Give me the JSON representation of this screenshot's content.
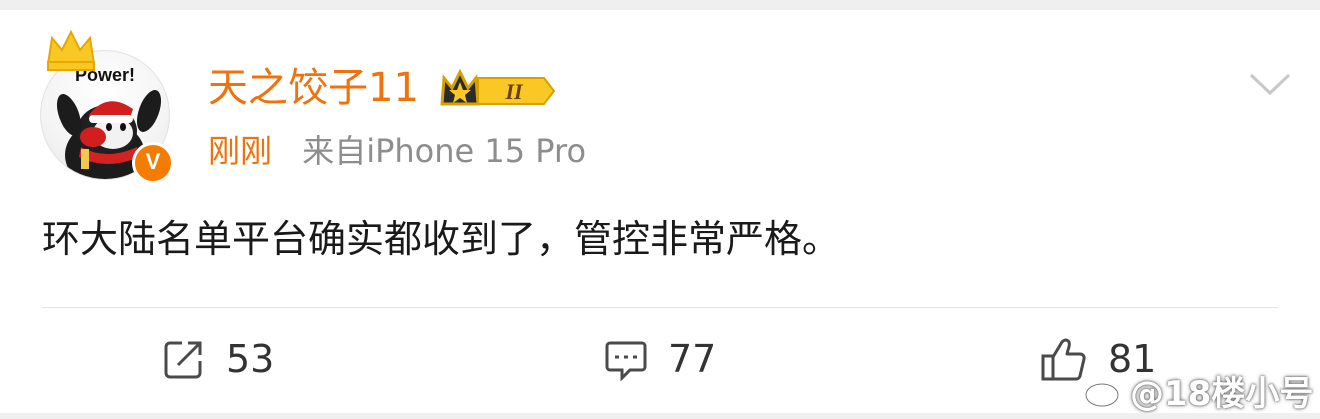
{
  "post": {
    "author": {
      "name": "天之饺子11",
      "avatar_text": "Power!",
      "verified_mark": "V",
      "level_badge": "II"
    },
    "time": "刚刚",
    "source": "来自iPhone 15 Pro",
    "content": "环大陆名单平台确实都收到了，管控非常严格。"
  },
  "actions": {
    "share_count": "53",
    "comment_count": "77",
    "like_count": "81"
  },
  "watermark": {
    "text": "@18楼小号"
  },
  "colors": {
    "accent": "#f0720c",
    "meta_gray": "#8d8d8d",
    "text": "#1a1a1a"
  },
  "icons": [
    "crown-icon",
    "verified-icon",
    "level-badge-icon",
    "chevron-down-icon",
    "share-icon",
    "comment-icon",
    "like-icon",
    "weibo-logo-icon"
  ]
}
